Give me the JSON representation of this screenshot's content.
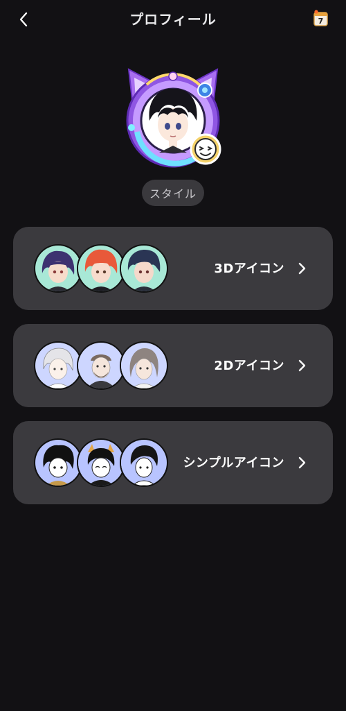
{
  "header": {
    "title": "プロフィール",
    "back_icon": "chevron-left-icon",
    "calendar_icon": "calendar-icon",
    "calendar_day": "7"
  },
  "profile": {
    "avatar_icon": "profile-avatar",
    "badge_icon": "smile-face-icon",
    "style_label": "スタイル"
  },
  "options": [
    {
      "label": "3Dアイコン",
      "icon": "chevron-right-icon"
    },
    {
      "label": "2Dアイコン",
      "icon": "chevron-right-icon"
    },
    {
      "label": "シンプルアイコン",
      "icon": "chevron-right-icon"
    }
  ],
  "colors": {
    "background": "#121114",
    "card": "#3b3a3e",
    "chip": "#3a393d",
    "frame_purple": "#9b5ce6",
    "badge_yellow": "#f5d36b"
  }
}
